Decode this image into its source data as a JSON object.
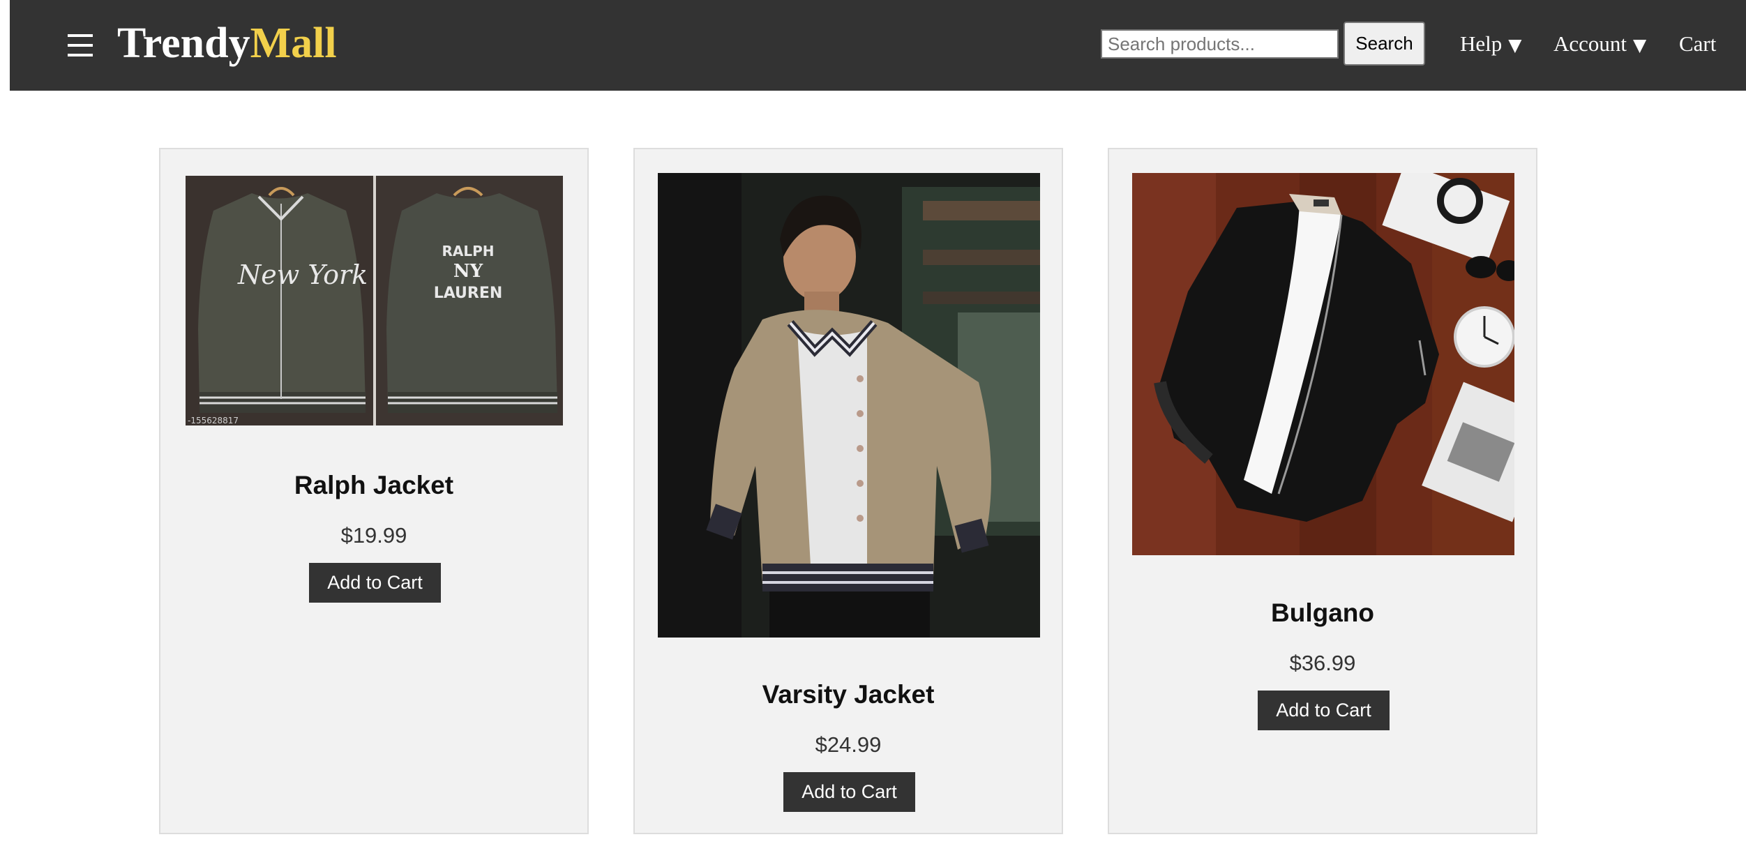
{
  "header": {
    "logo_main": "Trendy",
    "logo_accent": "Mall",
    "menu_icon": "hamburger-menu-icon",
    "search_placeholder": "Search products...",
    "search_value": "",
    "search_button_label": "Search",
    "nav": {
      "help_label": "Help",
      "account_label": "Account",
      "cart_label": "Cart",
      "caret_glyph": "▼"
    }
  },
  "products": [
    {
      "name": "Ralph Jacket",
      "price": "$19.99",
      "button_label": "Add to Cart"
    },
    {
      "name": "Varsity Jacket",
      "price": "$24.99",
      "button_label": "Add to Cart"
    },
    {
      "name": "Bulgano",
      "price": "$36.99",
      "button_label": "Add to Cart"
    }
  ],
  "photo_text": {
    "ralph_front_script": "New York",
    "ralph_back_top": "RALPH",
    "ralph_back_monogram": "NY",
    "ralph_back_bottom": "LAUREN",
    "ralph_watermark": "-155628817"
  },
  "colors": {
    "header_bg": "#333333",
    "logo_accent": "#f2d04b",
    "card_bg": "#f2f2f2",
    "button_bg": "#333333"
  }
}
